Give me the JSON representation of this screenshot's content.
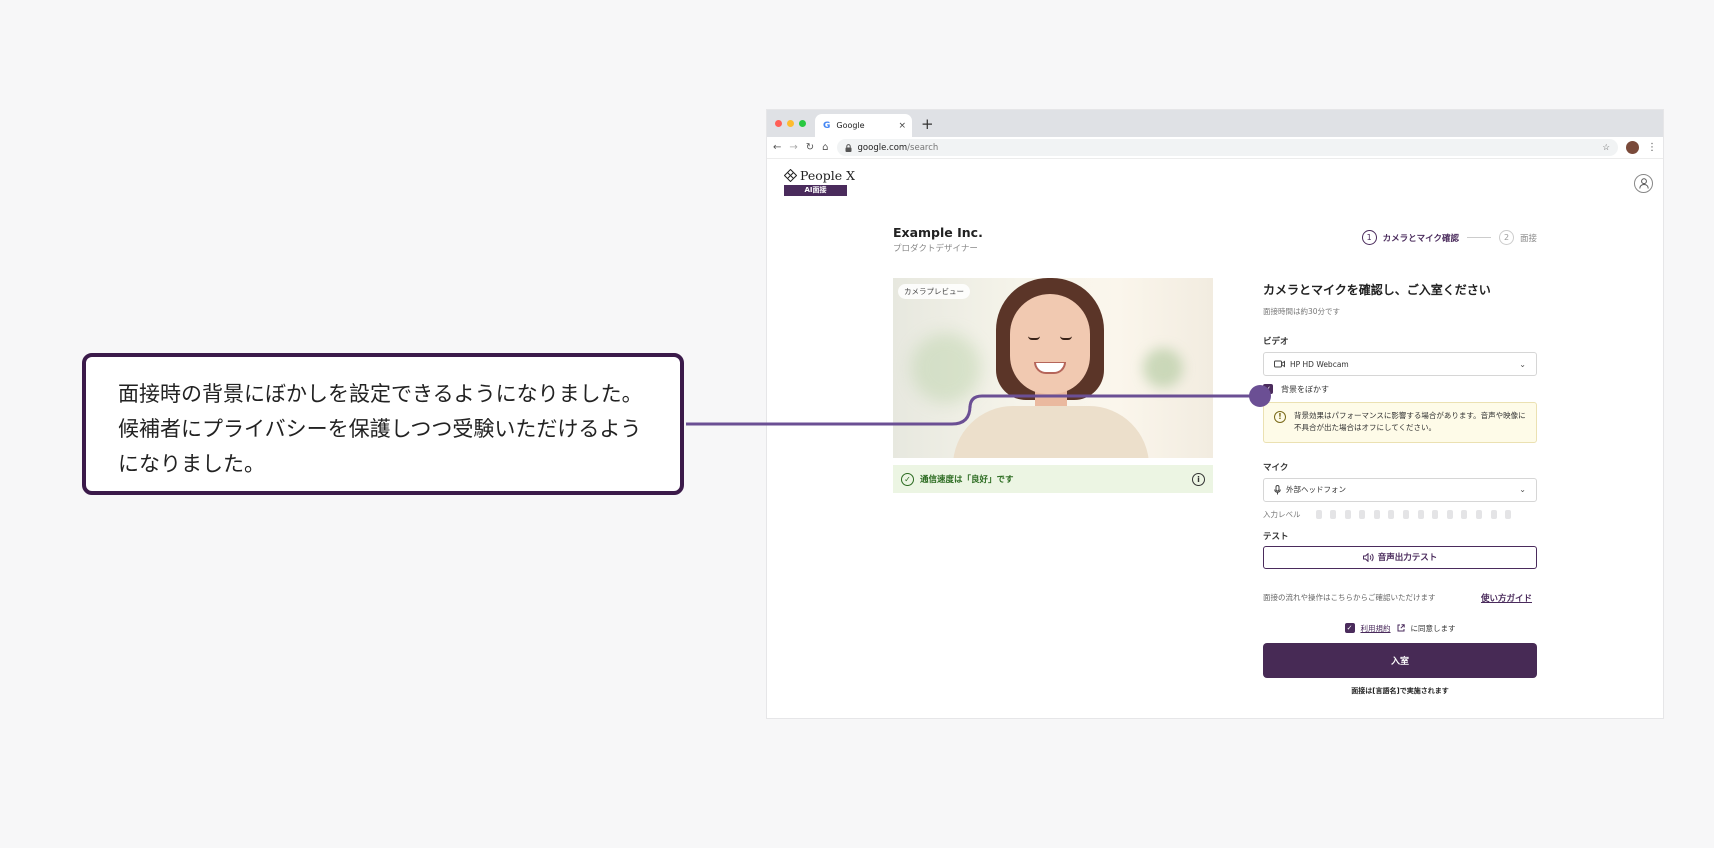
{
  "browser": {
    "tab_title": "Google",
    "tab_close": "×",
    "new_tab": "+",
    "url_host": "google.com",
    "url_path": "/search",
    "nav": {
      "back": "←",
      "forward": "→",
      "reload": "↻",
      "home": "⌂",
      "star": "☆",
      "menu": "⋮"
    },
    "traffic_colors": [
      "#ff5f57",
      "#febc2e",
      "#28c840"
    ]
  },
  "app": {
    "brand_name": "People X",
    "brand_badge": "AI面接",
    "company_name": "Example Inc.",
    "company_role": "プロダクトデザイナー",
    "steps": [
      {
        "num": "1",
        "label": "カメラとマイク確認"
      },
      {
        "num": "2",
        "label": "面接"
      }
    ],
    "preview_label": "カメラプレビュー",
    "status_text": "通信速度は「良好」です",
    "status_info": "i",
    "panel_title": "カメラとマイクを確認し、ご入室ください",
    "panel_sub": "面接時間は約30分です",
    "video_label": "ビデオ",
    "video_device": "HP HD Webcam",
    "blur_label": "背景をぼかす",
    "warn_text": "背景効果はパフォーマンスに影響する場合があります。音声や映像に不具合が出た場合はオフにしてください。",
    "warn_icon": "!",
    "mic_label": "マイク",
    "mic_device": "外部ヘッドフォン",
    "input_level_label": "入力レベル",
    "input_level": 0,
    "test_label": "テスト",
    "audio_test_button": "音声出力テスト",
    "guide_text": "面接の流れや操作はこちらからご確認いただけます",
    "guide_link": "使い方ガイド",
    "terms_link": "利用規約",
    "terms_suffix": "に同意します",
    "enter_button": "入室",
    "lang_note": "面接は[言語名]で実施されます",
    "accent_color": "#4a2b5c"
  },
  "callout": {
    "text": "面接時の背景にぼかしを設定できるようになりました。候補者にプライバシーを保護しつつ受験いただけるようになりました。"
  }
}
